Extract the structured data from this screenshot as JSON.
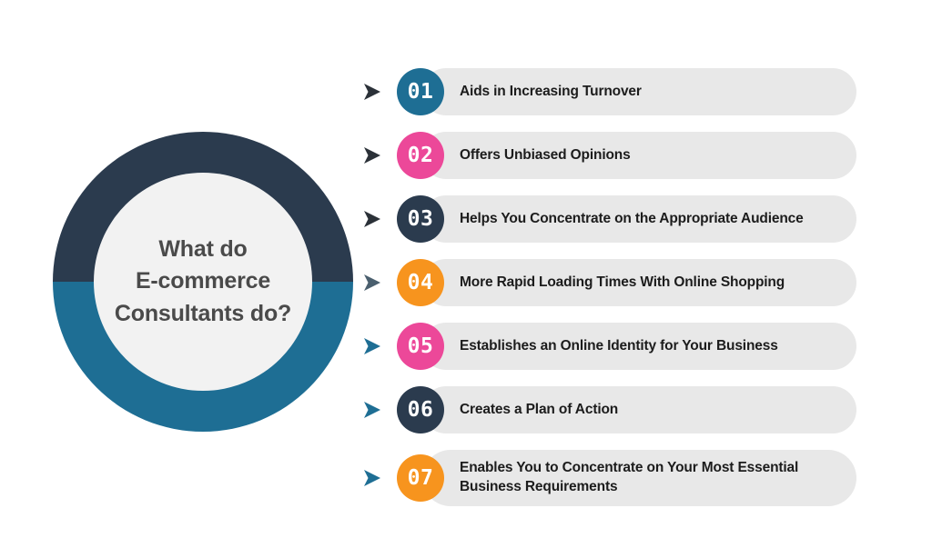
{
  "colors": {
    "navy": "#2B3B4E",
    "teal": "#1E6E94",
    "pink": "#EC4899",
    "orange": "#F7941E",
    "slate": "#4A5F6E",
    "dark_arrow": "#2B3138",
    "pill_bg": "#E8E8E8",
    "hole_bg": "#F2F2F2",
    "title_text": "#4A4A4A",
    "item_text": "#1C1C1C",
    "page_bg": "#FFFFFF"
  },
  "donut": {
    "title": "What do\nE-commerce\nConsultants do?",
    "top_half_color": "#2B3B4E",
    "bottom_half_color": "#1E6E94",
    "hole_color": "#F2F2F2"
  },
  "list": {
    "items": [
      {
        "number": "01",
        "label": "Aids in Increasing Turnover",
        "badge_color": "#1E6E94",
        "arrow_color": "#2B3138",
        "arrow_icon": "arrow-right-icon",
        "two_line": false
      },
      {
        "number": "02",
        "label": "Offers Unbiased Opinions",
        "badge_color": "#EC4899",
        "arrow_color": "#2B3138",
        "arrow_icon": "arrow-right-icon",
        "two_line": false
      },
      {
        "number": "03",
        "label": "Helps You Concentrate on the Appropriate Audience",
        "badge_color": "#2B3B4E",
        "arrow_color": "#2B3138",
        "arrow_icon": "arrow-right-icon",
        "two_line": false
      },
      {
        "number": "04",
        "label": "More Rapid Loading Times With Online Shopping",
        "badge_color": "#F7941E",
        "arrow_color": "#4A5F6E",
        "arrow_icon": "arrow-right-icon",
        "two_line": false
      },
      {
        "number": "05",
        "label": "Establishes an Online Identity for Your Business",
        "badge_color": "#EC4899",
        "arrow_color": "#1E6E94",
        "arrow_icon": "arrow-right-icon",
        "two_line": false
      },
      {
        "number": "06",
        "label": "Creates a Plan of Action",
        "badge_color": "#2B3B4E",
        "arrow_color": "#1E6E94",
        "arrow_icon": "arrow-right-icon",
        "two_line": false
      },
      {
        "number": "07",
        "label": "Enables You to Concentrate on Your Most Essential\nBusiness Requirements",
        "badge_color": "#F7941E",
        "arrow_color": "#1E6E94",
        "arrow_icon": "arrow-right-icon",
        "two_line": true
      }
    ]
  }
}
